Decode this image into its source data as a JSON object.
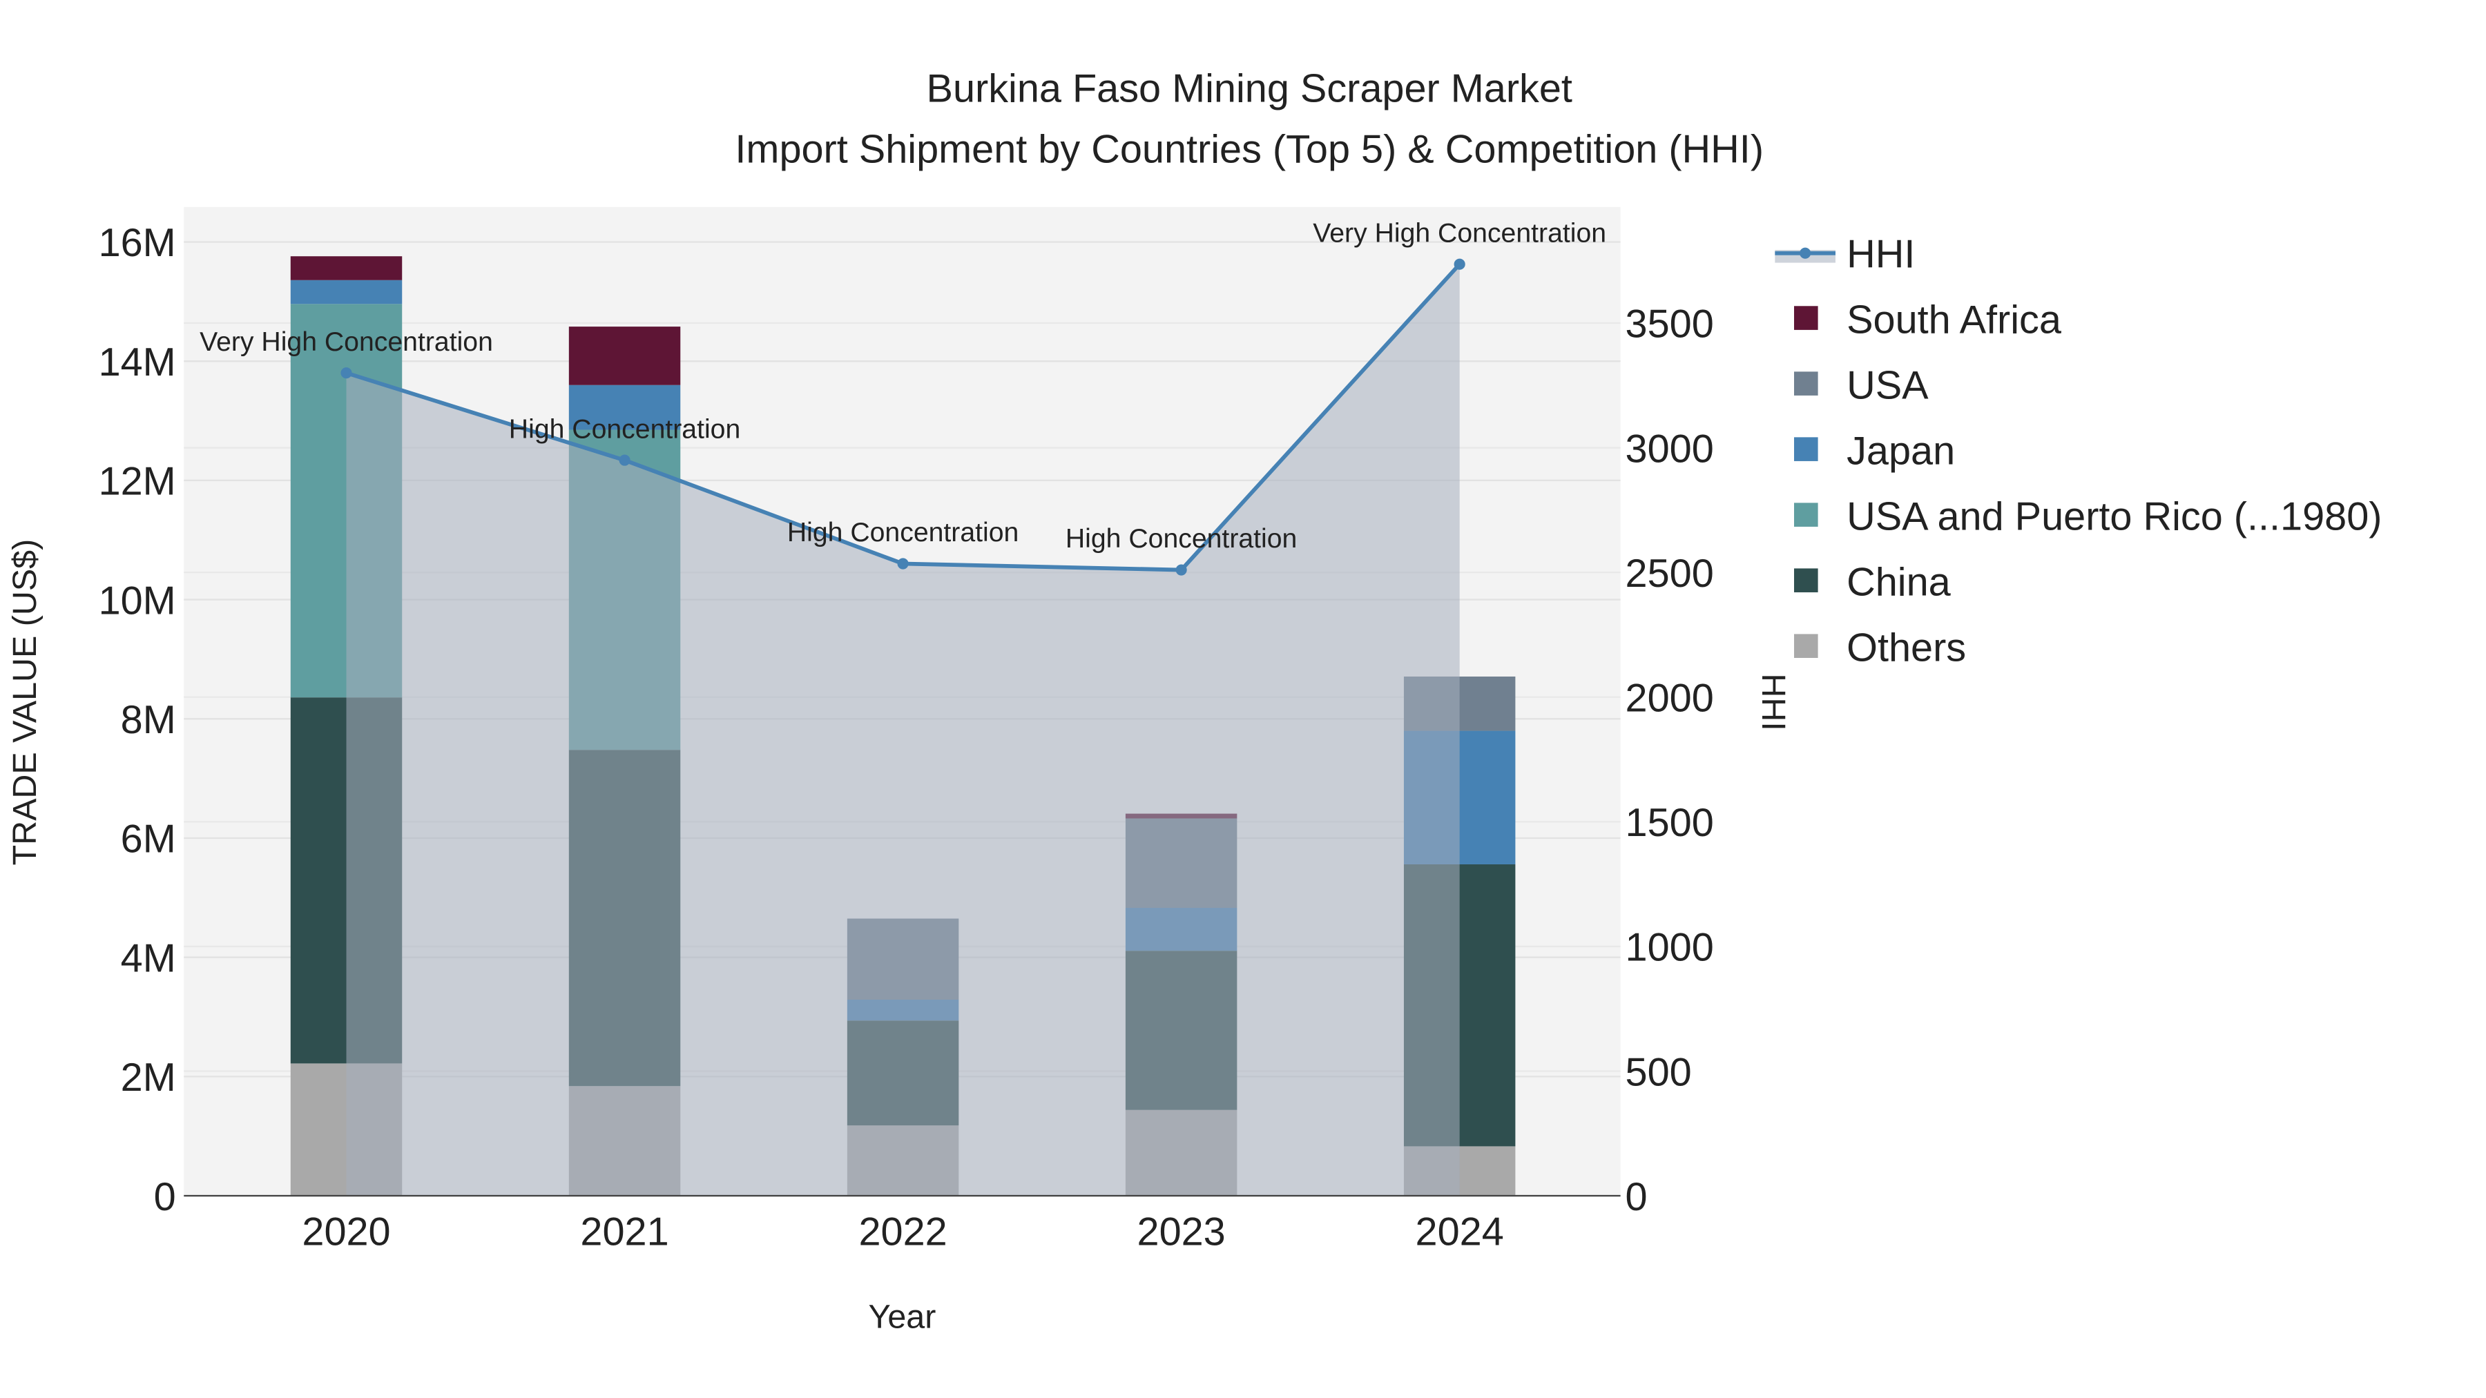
{
  "chart_data": {
    "type": "bar",
    "title": "Burkina Faso Mining Scraper Market",
    "subtitle": "Import Shipment by Countries (Top 5) & Competition (HHI)",
    "xlabel": "Year",
    "ylabel": "TRADE VALUE (US$)",
    "y2label": "HHI",
    "categories": [
      "2020",
      "2021",
      "2022",
      "2023",
      "2024"
    ],
    "ylim": [
      0,
      16.6
    ],
    "y2lim": [
      0,
      3950
    ],
    "yticks": [
      {
        "v": 0,
        "label": "0"
      },
      {
        "v": 2,
        "label": "2M"
      },
      {
        "v": 4,
        "label": "4M"
      },
      {
        "v": 6,
        "label": "6M"
      },
      {
        "v": 8,
        "label": "8M"
      },
      {
        "v": 10,
        "label": "10M"
      },
      {
        "v": 12,
        "label": "12M"
      },
      {
        "v": 14,
        "label": "14M"
      },
      {
        "v": 16,
        "label": "16M"
      }
    ],
    "y2ticks": [
      {
        "v": 0,
        "label": "0"
      },
      {
        "v": 500,
        "label": "500"
      },
      {
        "v": 1000,
        "label": "1000"
      },
      {
        "v": 1500,
        "label": "1500"
      },
      {
        "v": 2000,
        "label": "2000"
      },
      {
        "v": 2500,
        "label": "2500"
      },
      {
        "v": 3000,
        "label": "3000"
      },
      {
        "v": 3500,
        "label": "3500"
      }
    ],
    "value_unit": "million US$",
    "series": [
      {
        "name": "Others",
        "color": "#a9a9a9",
        "values": [
          2.22,
          1.84,
          1.18,
          1.44,
          0.83
        ]
      },
      {
        "name": "China",
        "color": "#2f4f4f",
        "values": [
          6.14,
          5.64,
          1.76,
          2.67,
          4.73
        ]
      },
      {
        "name": "USA and Puerto Rico (...1980)",
        "color": "#5f9ea0",
        "values": [
          6.6,
          5.37,
          0,
          0,
          0
        ]
      },
      {
        "name": "Japan",
        "color": "#4682b4",
        "values": [
          0.4,
          0.75,
          0.35,
          0.72,
          2.24
        ]
      },
      {
        "name": "USA",
        "color": "#708090",
        "values": [
          0,
          0,
          1.36,
          1.5,
          0.91
        ]
      },
      {
        "name": "South Africa",
        "color": "#5e1535",
        "values": [
          0.4,
          0.98,
          0,
          0.08,
          0
        ]
      }
    ],
    "hhi": {
      "name": "HHI",
      "color": "#4682b4",
      "values": [
        3300,
        2950,
        2535,
        2510,
        3736
      ],
      "annotations": [
        "Very High Concentration",
        "High Concentration",
        "High Concentration",
        "High Concentration",
        "Very High Concentration"
      ]
    },
    "legend": {
      "placement": "right",
      "order": [
        "HHI",
        "South Africa",
        "USA",
        "Japan",
        "USA and Puerto Rico (...1980)",
        "China",
        "Others"
      ]
    },
    "grid": true
  }
}
